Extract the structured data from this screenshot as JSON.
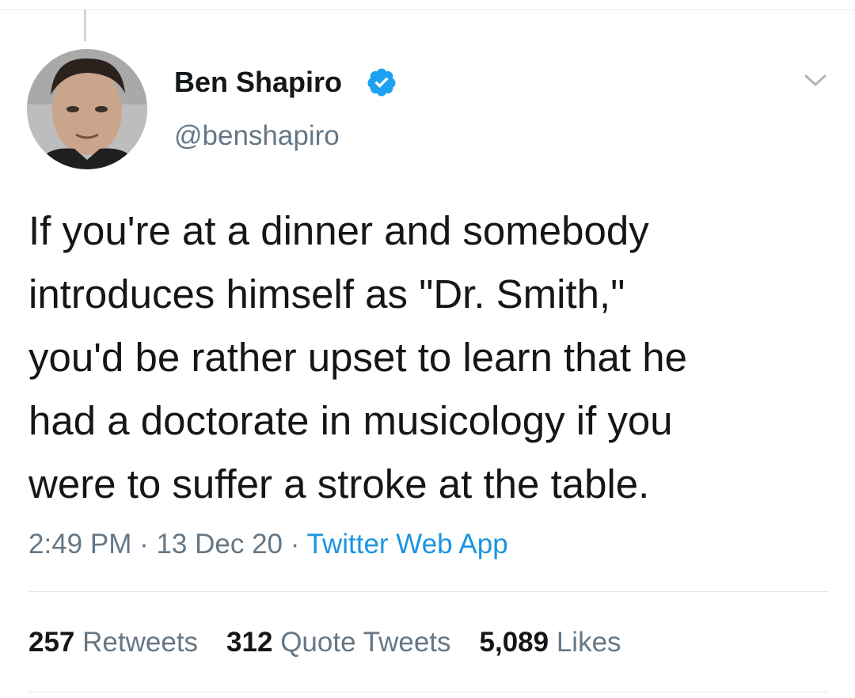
{
  "tweet": {
    "author": {
      "display_name": "Ben Shapiro",
      "handle": "@benshapiro",
      "verified": true,
      "verified_color": "#1da1f2"
    },
    "text_lines": [
      "If you're at a dinner and somebody",
      "introduces himself as \"Dr. Smith,\"",
      "you'd be rather upset to learn that he",
      "had a doctorate in musicology if you",
      "were to suffer a stroke at the table."
    ],
    "meta": {
      "time": "2:49 PM",
      "separator": " · ",
      "date": "13 Dec 20",
      "source": "Twitter Web App"
    },
    "stats": {
      "retweets_count": "257",
      "retweets_label": "Retweets",
      "quotes_count": "312",
      "quotes_label": "Quote Tweets",
      "likes_count": "5,089",
      "likes_label": "Likes"
    },
    "icons": {
      "menu": "chevron-down-icon",
      "verified": "verified-badge-icon"
    },
    "colors": {
      "link": "#1b95e0",
      "secondary_text": "#657786",
      "primary_text": "#14171a"
    }
  }
}
